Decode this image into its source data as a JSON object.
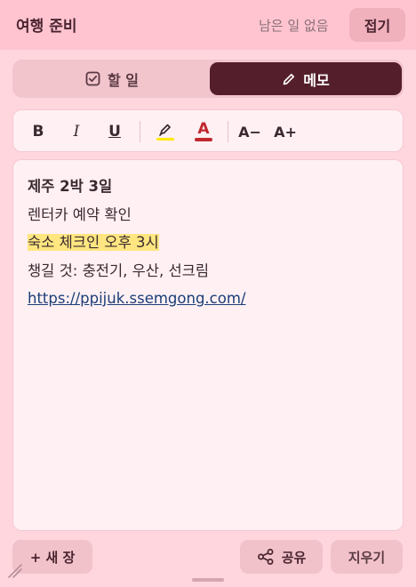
{
  "header": {
    "title": "여행 준비",
    "status": "남은 일 없음",
    "fold_label": "접기"
  },
  "tabs": [
    {
      "label": "할 일",
      "icon": "checkbox-icon",
      "selected": false
    },
    {
      "label": "메모",
      "icon": "pencil-icon",
      "selected": true
    }
  ],
  "toolbar": {
    "bold": "B",
    "italic": "I",
    "underline": "U",
    "highlight_icon": "highlighter-icon",
    "highlight_color": "#ffea00",
    "text_color_label": "A",
    "text_color": "#c0282e",
    "decrease_font": "A−",
    "increase_font": "A+"
  },
  "memo": {
    "lines": [
      "제주 2박 3일",
      "렌터카 예약 확인",
      "숙소 체크인 오후 3시",
      "챙길 것: 충전기, 우산, 선크림",
      "https://ppijuk.ssemgong.com/"
    ]
  },
  "footer": {
    "new_page": "+ 새 장",
    "share": "공유",
    "share_icon": "share-icon",
    "clear": "지우기"
  },
  "colors": {
    "accent_dark": "#551e2b",
    "background": "#ffd6de",
    "header_bg": "#ffc4d0"
  }
}
